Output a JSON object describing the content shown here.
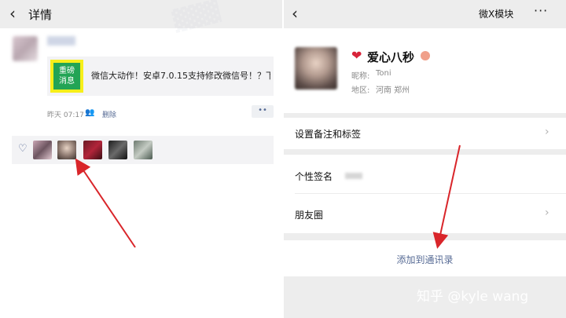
{
  "left": {
    "header": {
      "back_icon": "chevron-left-icon",
      "title": "详情"
    },
    "share": {
      "icon_line1": "重磅",
      "icon_line2": "消息",
      "text": "微信大动作！安卓7.0.15支持修改微信号！？下..."
    },
    "meta": {
      "time": "昨天 07:17",
      "delete_label": "删除",
      "more_label": "••"
    },
    "likes": {
      "icon": "heart-outline-icon"
    }
  },
  "right": {
    "header": {
      "back_icon": "chevron-left-icon",
      "title": "微X模块",
      "more_label": "···"
    },
    "profile": {
      "heart": "❤",
      "name": "爱心八秒",
      "nickname_label": "昵称:",
      "nickname_value": "Toni",
      "region_label": "地区:",
      "region_value": "河南  郑州"
    },
    "rows": {
      "remark": "设置备注和标签",
      "signature": "个性签名",
      "moments": "朋友圈"
    },
    "add_contact": "添加到通讯录"
  },
  "watermark": "知乎 @kyle wang",
  "colors": {
    "link": "#576b95",
    "arrow": "#d9252a",
    "share_icon_bg": "#23a455",
    "share_icon_border": "#f7ef1a"
  }
}
